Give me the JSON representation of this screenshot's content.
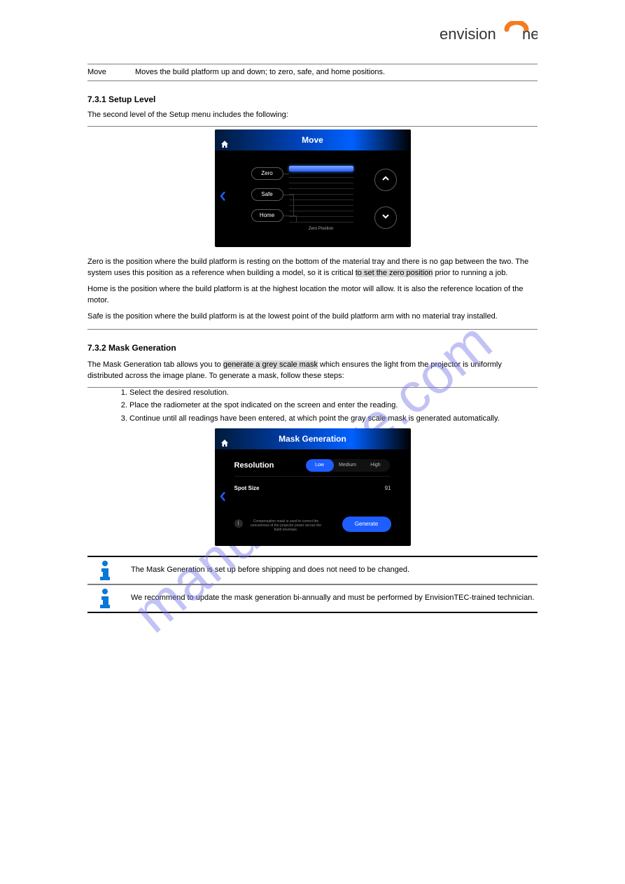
{
  "watermark": "manualshive.com",
  "logo": {
    "text_left": "envision",
    "text_right": "ne"
  },
  "table1": {
    "col1": "Move",
    "col2": "Moves the build platform up and down; to zero, safe, and home positions."
  },
  "sl_heading": "7.3.1 Setup Level",
  "sl_text": "The second level of the Setup menu includes the following:",
  "move_panel": {
    "title": "Move",
    "btn_zero": "Zero",
    "btn_safe": "Safe",
    "btn_home": "Home",
    "pos_label": "Zero Position"
  },
  "move_para1_a": "Zero is the position where the build platform is resting on the bottom of the material tray and there is no gap between the two. The system uses this position as a reference when building a model, so it is critical ",
  "move_para1_b": "to set the zero position",
  "move_para1_c": " prior to running a job.",
  "move_para2": "Home is the position where the build platform is at the highest location the motor will allow. It is also the reference location of the motor.",
  "move_para3": "Safe is the position where the build platform is at the lowest point of the build platform arm with no material tray installed.",
  "mask_heading": "7.3.2 Mask Generation",
  "mask_intro_a": "The Mask Generation tab allows you to ",
  "mask_intro_b": "generate a grey scale mask",
  "mask_intro_c": " which ensures the light from the projector is uniformly distributed across the image plane",
  "mask_intro_d": ". To generate a mask, follow these steps:",
  "steps": [
    "Select the desired resolution.",
    "Place the radiometer at the spot indicated on the screen and enter the reading.",
    "Continue until all readings have been entered, at which point the gray scale mask is generated automatically."
  ],
  "mask_panel": {
    "title": "Mask Generation",
    "resolution_label": "Resolution",
    "opts": {
      "low": "Low",
      "medium": "Medium",
      "high": "High"
    },
    "spot_label": "Spot Size",
    "spot_value": "91",
    "info": "Compensation mask is used to correct the unevenness of the projector power across the build envelope.",
    "generate": "Generate"
  },
  "note1": "The Mask Generation is set up before shipping and does not need to be changed.",
  "note2": "We recommend to update the mask generation bi-annually and must be performed by EnvisionTEC-trained technician."
}
